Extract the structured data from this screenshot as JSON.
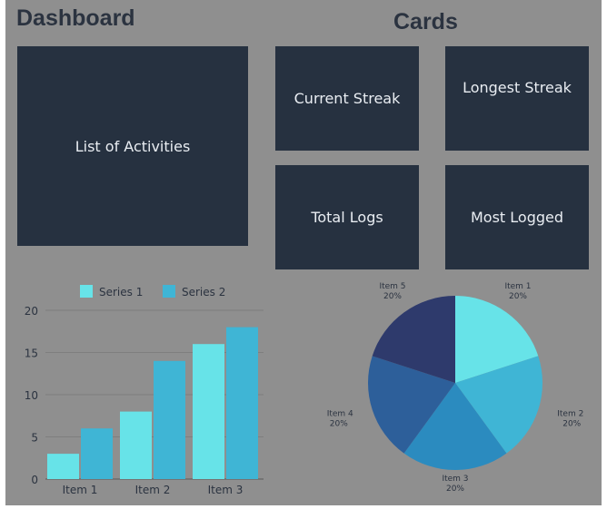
{
  "dashboard_title": "Dashboard",
  "cards_title": "Cards",
  "activities_panel": "List of Activities",
  "cards": {
    "current_streak": "Current Streak",
    "longest_streak": "Longest Streak",
    "total_logs": "Total Logs",
    "most_logged": "Most Logged"
  },
  "colors": {
    "panel": "#263140",
    "background": "#8f8f8f",
    "series1": "#67e3e8",
    "series2": "#3fb5d5",
    "pie": [
      "#67e3e8",
      "#3fb5d5",
      "#2b8bbf",
      "#2d5f9a",
      "#2e3a6c"
    ]
  },
  "chart_data": [
    {
      "type": "bar",
      "categories": [
        "Item 1",
        "Item 2",
        "Item 3"
      ],
      "series": [
        {
          "name": "Series 1",
          "values": [
            3,
            8,
            16
          ]
        },
        {
          "name": "Series 2",
          "values": [
            6,
            14,
            18
          ]
        }
      ],
      "yticks": [
        "0",
        "5",
        "10",
        "15",
        "20"
      ],
      "ylim": [
        0,
        20
      ],
      "grid": true,
      "legend_position": "top"
    },
    {
      "type": "pie",
      "labels": [
        "Item 1",
        "Item 2",
        "Item 3",
        "Item 4",
        "Item 5"
      ],
      "values": [
        20,
        20,
        20,
        20,
        20
      ],
      "value_labels": [
        "20%",
        "20%",
        "20%",
        "20%",
        "20%"
      ]
    }
  ]
}
